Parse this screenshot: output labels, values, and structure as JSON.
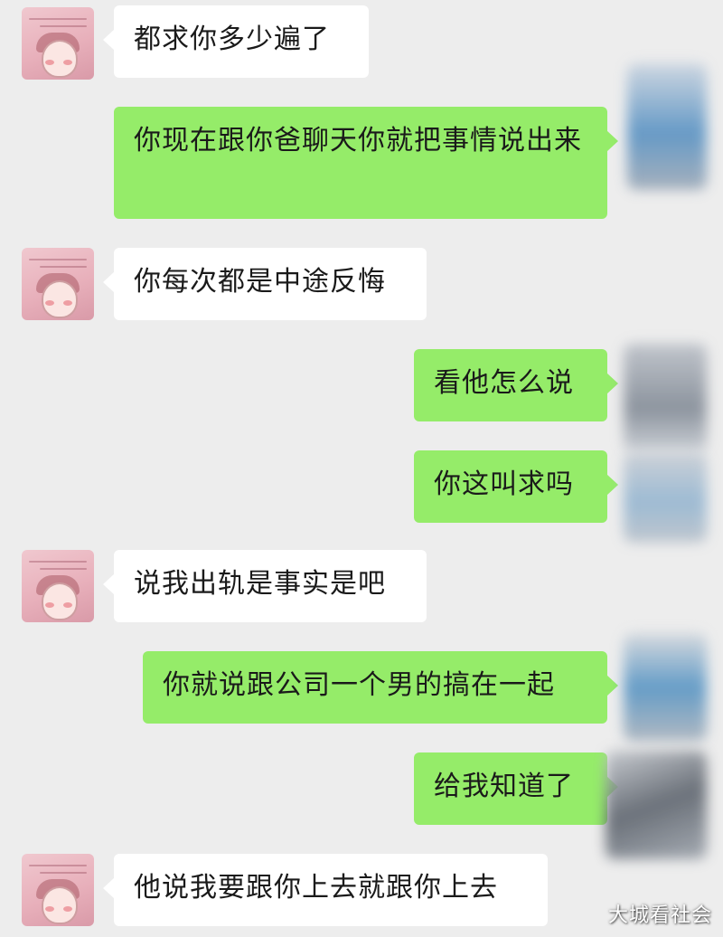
{
  "colors": {
    "background": "#ededed",
    "incoming_bubble": "#ffffff",
    "outgoing_bubble": "#95ec69",
    "text": "#1a1a1a"
  },
  "messages": [
    {
      "side": "in",
      "text": "都求你多少遍了"
    },
    {
      "side": "out",
      "text": "你现在跟你爸聊天你就把事情说出来"
    },
    {
      "side": "in",
      "text": "你每次都是中途反悔"
    },
    {
      "side": "out",
      "text": "看他怎么说"
    },
    {
      "side": "out",
      "text": "你这叫求吗"
    },
    {
      "side": "in",
      "text": "说我出轨是事实是吧"
    },
    {
      "side": "out",
      "text": "你就说跟公司一个男的搞在一起"
    },
    {
      "side": "out",
      "text": "给我知道了"
    },
    {
      "side": "in",
      "text": "他说我要跟你上去就跟你上去"
    }
  ],
  "icons": {
    "contact_avatar": "contact-avatar-icon",
    "own_avatar": "own-avatar-icon"
  },
  "watermark": "大城看社会"
}
